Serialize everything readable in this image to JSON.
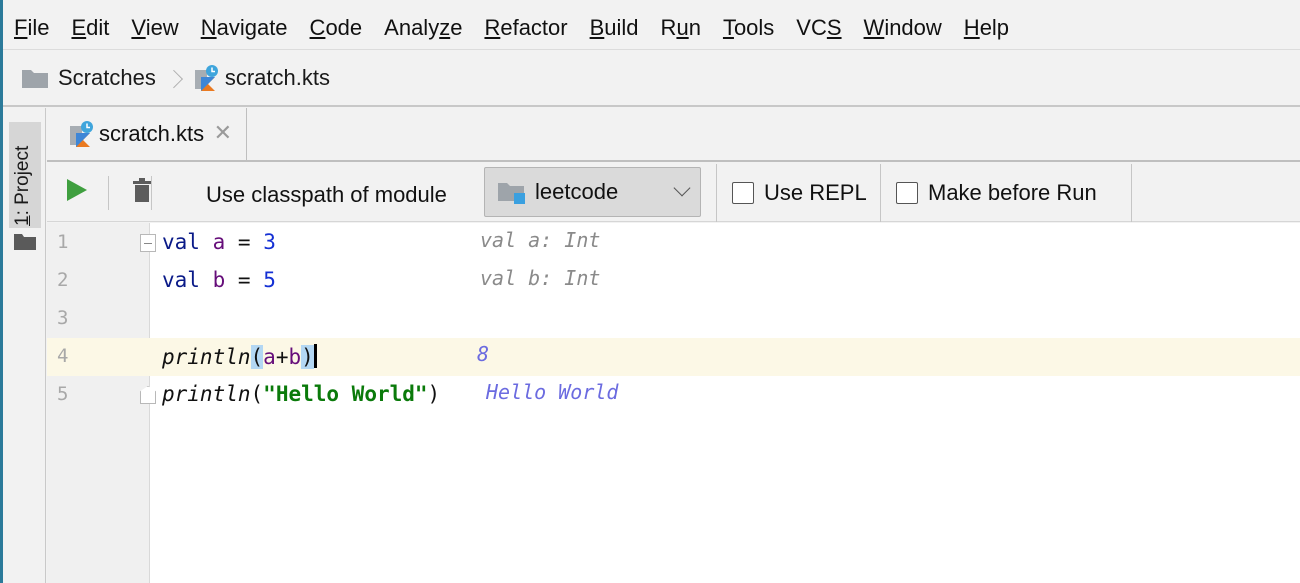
{
  "menu": {
    "items": [
      {
        "label": "File",
        "mnemonic_index": 0
      },
      {
        "label": "Edit",
        "mnemonic_index": 0
      },
      {
        "label": "View",
        "mnemonic_index": 0
      },
      {
        "label": "Navigate",
        "mnemonic_index": 0
      },
      {
        "label": "Code",
        "mnemonic_index": 0
      },
      {
        "label": "Analyze",
        "mnemonic_index": 5
      },
      {
        "label": "Refactor",
        "mnemonic_index": 0
      },
      {
        "label": "Build",
        "mnemonic_index": 0
      },
      {
        "label": "Run",
        "mnemonic_index": 1
      },
      {
        "label": "Tools",
        "mnemonic_index": 0
      },
      {
        "label": "VCS",
        "mnemonic_index": 2
      },
      {
        "label": "Window",
        "mnemonic_index": 0
      },
      {
        "label": "Help",
        "mnemonic_index": 0
      }
    ]
  },
  "breadcrumb": {
    "folder": "Scratches",
    "file": "scratch.kts"
  },
  "toolwindow": {
    "number": "1",
    "label": ": Project"
  },
  "editor_tab": {
    "label": "scratch.kts",
    "close": "✕"
  },
  "scratch_toolbar": {
    "classpath_label": "Use classpath of module",
    "module_value": "leetcode",
    "use_repl_label": "Use REPL",
    "use_repl_checked": false,
    "make_before_run_label": "Make before Run",
    "make_before_run_checked": false
  },
  "code": {
    "lines": [
      {
        "number": "1",
        "kw": "val",
        "var": "a",
        "eq": " = ",
        "num": "3",
        "result": "val a: Int"
      },
      {
        "number": "2",
        "kw": "val",
        "var": "b",
        "eq": " = ",
        "num": "5",
        "result": "val b: Int"
      },
      {
        "number": "3"
      },
      {
        "number": "4",
        "fn": "println",
        "open": "(",
        "arg1": "a",
        "plus": "+",
        "arg2": "b",
        "close": ")",
        "result": "8"
      },
      {
        "number": "5",
        "fn": "println",
        "open": "(",
        "str": "\"Hello World\"",
        "close": ")",
        "result": "Hello World"
      }
    ]
  },
  "colors": {
    "run_green": "#3f9f3f",
    "keyword": "#0a1a88",
    "variable": "#660e7a",
    "number": "#1430d4",
    "string": "#0a7a0a",
    "current_line": "#fcf8e6",
    "output_result": "#6b6be0"
  }
}
